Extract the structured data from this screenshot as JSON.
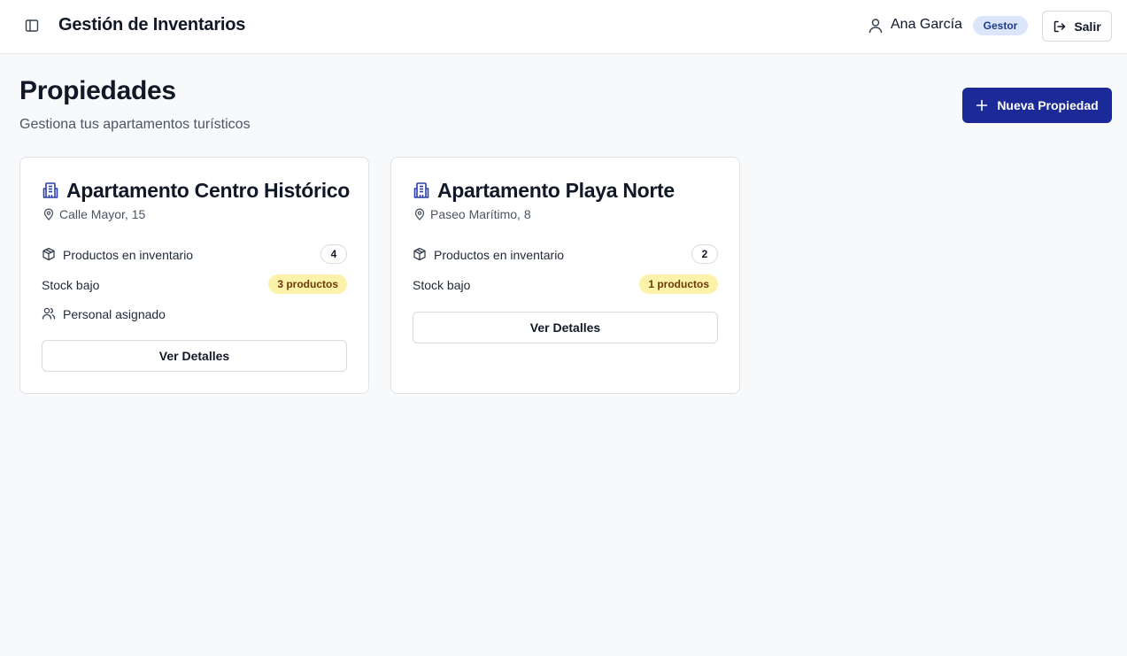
{
  "header": {
    "app_title": "Gestión de Inventarios",
    "user_name": "Ana García",
    "role": "Gestor",
    "logout_label": "Salir"
  },
  "page": {
    "title": "Propiedades",
    "subtitle": "Gestiona tus apartamentos turísticos",
    "new_button_label": "Nueva Propiedad"
  },
  "properties": [
    {
      "name": "Apartamento Centro Histórico",
      "address": "Calle Mayor, 15",
      "products_label": "Productos en inventario",
      "products_count": "4",
      "low_stock_label": "Stock bajo",
      "low_stock_value": "3 productos",
      "staff_label": "Personal asignado",
      "details_label": "Ver Detalles"
    },
    {
      "name": "Apartamento Playa Norte",
      "address": "Paseo Marítimo, 8",
      "products_label": "Productos en inventario",
      "products_count": "2",
      "low_stock_label": "Stock bajo",
      "low_stock_value": "1 productos",
      "details_label": "Ver Detalles"
    }
  ],
  "colors": {
    "primary": "#1b2a96",
    "badge_role_bg": "#dbe6fb",
    "low_stock_bg": "#fdf2a9",
    "icon_accent": "#2c3ea8"
  },
  "icons": {
    "sidebar_toggle": "panel-left-icon",
    "user": "user-icon",
    "logout": "log-out-icon",
    "add": "plus-icon",
    "building": "building-icon",
    "location": "map-pin-icon",
    "package": "package-icon",
    "staff": "users-icon"
  }
}
